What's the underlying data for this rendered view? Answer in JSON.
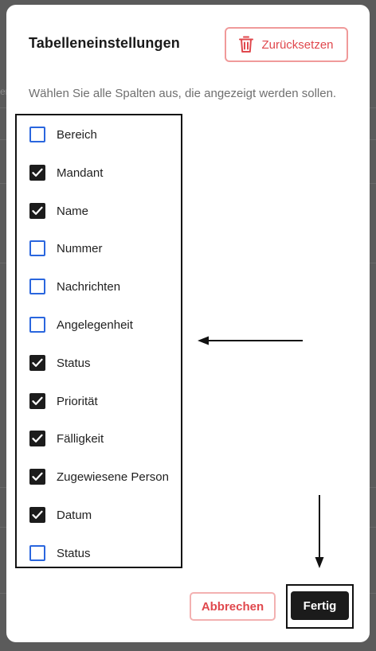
{
  "dialog": {
    "title": "Tabelleneinstellungen",
    "reset_label": "Zurücksetzen",
    "subtitle": "Wählen Sie alle Spalten aus, die angezeigt werden sollen.",
    "columns": [
      {
        "label": "Bereich",
        "checked": false
      },
      {
        "label": "Mandant",
        "checked": true
      },
      {
        "label": "Name",
        "checked": true
      },
      {
        "label": "Nummer",
        "checked": false
      },
      {
        "label": "Nachrichten",
        "checked": false
      },
      {
        "label": "Angelegenheit",
        "checked": false
      },
      {
        "label": "Status",
        "checked": true
      },
      {
        "label": "Priorität",
        "checked": true
      },
      {
        "label": "Fälligkeit",
        "checked": true
      },
      {
        "label": "Zugewiesene Person",
        "checked": true
      },
      {
        "label": "Datum",
        "checked": true
      },
      {
        "label": "Status",
        "checked": false
      }
    ],
    "cancel_label": "Abbrechen",
    "done_label": "Fertig"
  },
  "background": {
    "peek_text": "er"
  },
  "colors": {
    "accent_red": "#e0484d",
    "checkbox_blue": "#2a66de",
    "checked_fill": "#1c1c1c"
  },
  "icons": {
    "reset": "trash-icon",
    "checked": "check-icon"
  }
}
